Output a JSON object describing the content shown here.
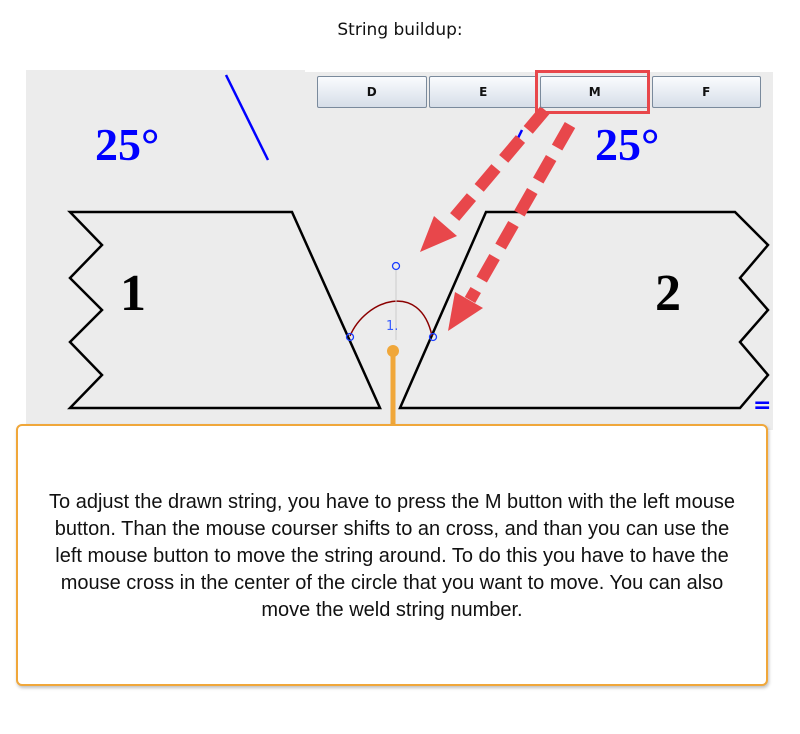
{
  "heading": "String buildup:",
  "toolbar": {
    "buttons": [
      "D",
      "E",
      "M",
      "F"
    ],
    "highlighted": "M"
  },
  "diagram": {
    "angle_left": "25°",
    "angle_right": "25°",
    "piece_left_label": "1",
    "piece_right_label": "2",
    "string_number": "1.",
    "edge_marker": "="
  },
  "callout": {
    "text": "To adjust the drawn string, you have to press the M button with the left mouse button. Than the mouse courser shifts to an cross, and than you can use the left mouse button to move the string around. To do this you have to have the mouse cross in the center of the circle that you want to move. You can also move the weld string number."
  },
  "colors": {
    "canvas_bg": "#ececec",
    "angle_text": "#0000ff",
    "arrow": "#e8474b",
    "highlight": "#e8474b",
    "callout_border": "#f0a73a",
    "leader": "#f0a73a",
    "weld_string": "#8b0000"
  }
}
